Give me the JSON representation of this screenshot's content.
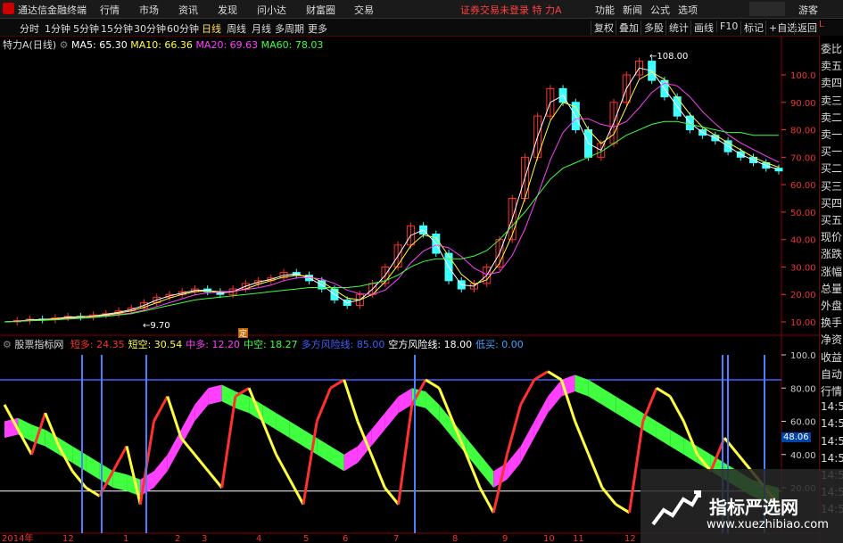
{
  "titlebar": {
    "app_name": "通达信金融终端",
    "menu": [
      "行情",
      "市场",
      "资讯",
      "发现",
      "问小达",
      "财富圈",
      "交易"
    ],
    "login_status": "证券交易未登录",
    "stock_name": "特 力A",
    "right_menu": [
      "功能",
      "新闻",
      "公式",
      "选项"
    ],
    "guest": "游客"
  },
  "toolbar": {
    "periods": [
      "分时",
      "1分钟",
      "5分钟",
      "15分钟",
      "30分钟",
      "60分钟",
      "日线",
      "周线",
      "月线",
      "多周期",
      "更多"
    ],
    "active_period": "日线",
    "right_tools": [
      "复权",
      "叠加",
      "多股",
      "统计",
      "画线",
      "F10",
      "标记",
      "+自选",
      "返回"
    ]
  },
  "legend_main": {
    "stock": "特力A",
    "period": "(日线)",
    "ma5": "MA5: 65.30",
    "ma10": "MA10: 66.36",
    "ma20": "MA20: 69.63",
    "ma60": "MA60: 78.03"
  },
  "legend_sub": {
    "name": "股票指标网",
    "items": [
      {
        "label": "短多:",
        "value": "24.35",
        "color": "#ff3030"
      },
      {
        "label": "短空:",
        "value": "30.54",
        "color": "#ffff40"
      },
      {
        "label": "中多:",
        "value": "12.20",
        "color": "#ff40ff"
      },
      {
        "label": "中空:",
        "value": "18.27",
        "color": "#40ff40"
      },
      {
        "label": "多方风险线:",
        "value": "85.00",
        "color": "#4060ff"
      },
      {
        "label": "空方风险线:",
        "value": "18.00",
        "color": "#ffffff"
      },
      {
        "label": "低买:",
        "value": "0.00",
        "color": "#40a0ff"
      }
    ]
  },
  "main_axis": [
    "100.0",
    "90.00",
    "80.00",
    "70.00",
    "60.00",
    "50.00",
    "40.00",
    "30.00",
    "20.00",
    "10.00"
  ],
  "sub_axis": [
    "100.0",
    "80.00",
    "60.00",
    "48.06",
    "40.00",
    "20.00"
  ],
  "right_panel": [
    "L",
    "委比",
    "卖五",
    "卖四",
    "卖三",
    "卖二",
    "卖一",
    "买一",
    "买二",
    "买三",
    "买四",
    "买五",
    "现价",
    "涨跌",
    "涨幅",
    "总量",
    "外盘",
    "换手",
    "净资",
    "收益",
    "自动",
    "行情",
    "14:50",
    "14:50",
    "14:50",
    "14:50",
    "14:50",
    "14:50",
    "14:50"
  ],
  "annotations": {
    "high": "108.00",
    "low": "9.70",
    "event": "定"
  },
  "current_value": "48.06",
  "x_labels": [
    "2014年",
    "12",
    "1",
    "2",
    "3",
    "4",
    "5",
    "6",
    "7",
    "8",
    "9",
    "10",
    "11",
    "12"
  ],
  "watermark": {
    "title": "指标严选网",
    "url": "www.xuezhibiao.com"
  },
  "colors": {
    "up": "#ff3030",
    "down": "#40ffff",
    "ma5": "#ffffff",
    "ma10": "#ffff40",
    "ma20": "#ff40ff",
    "ma60": "#40ff40"
  },
  "chart_data": {
    "type": "line",
    "main_price_close": [
      10,
      10.5,
      11,
      10.8,
      11.5,
      12,
      11.8,
      12.5,
      13,
      14,
      15,
      17,
      19,
      20,
      21,
      22,
      21,
      20,
      22,
      24,
      25,
      26,
      28,
      27,
      25,
      22,
      18,
      16,
      20,
      24,
      30,
      38,
      45,
      42,
      35,
      25,
      22,
      24,
      30,
      40,
      55,
      70,
      85,
      95,
      90,
      80,
      70,
      75,
      90,
      100,
      105,
      98,
      92,
      85,
      80,
      78,
      76,
      72,
      70,
      68,
      66,
      65
    ],
    "ma60": [
      10,
      10.2,
      10.4,
      10.6,
      10.8,
      11,
      11.3,
      11.6,
      12,
      12.5,
      13,
      14,
      15,
      16,
      17,
      18,
      18.5,
      19,
      19.5,
      20,
      20.5,
      21,
      21.5,
      22,
      22.5,
      22.5,
      22.5,
      22.5,
      23,
      24,
      25,
      27,
      30,
      32,
      33,
      33,
      33,
      34,
      36,
      40,
      45,
      50,
      56,
      62,
      66,
      68,
      70,
      72,
      75,
      78,
      80,
      82,
      83,
      83,
      82,
      81,
      80,
      79,
      79,
      78,
      78,
      78
    ],
    "sub_short": [
      70,
      55,
      40,
      65,
      45,
      30,
      20,
      15,
      30,
      45,
      10,
      60,
      75,
      50,
      40,
      30,
      20,
      75,
      80,
      60,
      40,
      25,
      10,
      60,
      80,
      85,
      60,
      40,
      20,
      10,
      70,
      85,
      80,
      60,
      40,
      20,
      5,
      40,
      70,
      85,
      90,
      85,
      60,
      40,
      20,
      10,
      5,
      60,
      80,
      75,
      60,
      40,
      30,
      50,
      40,
      30,
      20,
      10
    ],
    "sub_mid": [
      60,
      62,
      58,
      55,
      50,
      45,
      40,
      35,
      30,
      28,
      25,
      30,
      40,
      55,
      70,
      80,
      82,
      78,
      75,
      70,
      65,
      60,
      55,
      50,
      45,
      40,
      45,
      55,
      65,
      75,
      80,
      78,
      70,
      60,
      50,
      40,
      30,
      35,
      45,
      60,
      75,
      85,
      88,
      85,
      80,
      75,
      70,
      65,
      60,
      55,
      50,
      45,
      40,
      35,
      30,
      25,
      22,
      20
    ]
  }
}
